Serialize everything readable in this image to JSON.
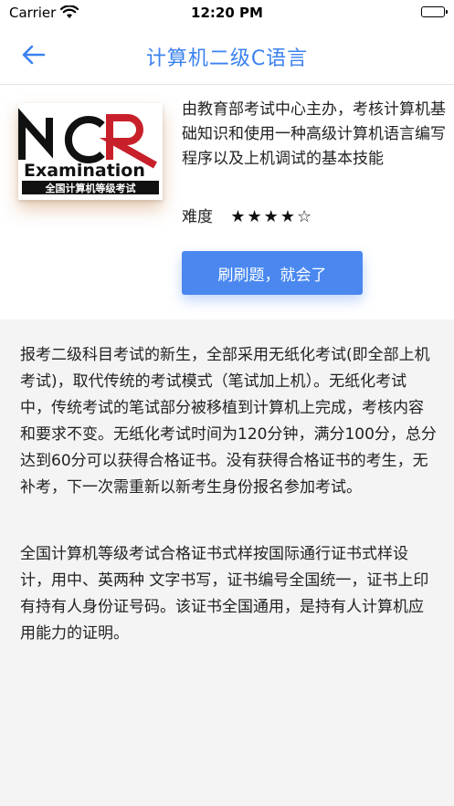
{
  "status_bar": {
    "carrier": "Carrier",
    "time": "12:20 PM"
  },
  "nav": {
    "title": "计算机二级C语言"
  },
  "logo": {
    "text_main": "Examination",
    "text_sub": "全国计算机等级考试"
  },
  "info": {
    "description": "由教育部考试中心主办，考核计算机基础知识和使用一种高级计算机语言编写程序以及上机调试的基本技能",
    "difficulty_label": "难度",
    "difficulty_stars": "★★★★☆",
    "difficulty_value": 4,
    "difficulty_max": 5,
    "cta_label": "刷刷题，就会了"
  },
  "content": {
    "paragraph_1": "报考二级科目考试的新生，全部采用无纸化考试(即全部上机考试)，取代传统的考试模式（笔试加上机）。无纸化考试中，传统考试的笔试部分被移植到计算机上完成，考核内容和要求不变。无纸化考试时间为120分钟，满分100分，总分达到60分可以获得合格证书。没有获得合格证书的考生，无补考，下一次需重新以新考生身份报名参加考试。",
    "paragraph_2": "全国计算机等级考试合格证书式样按国际通行证书式样设计，用中、英两种 文字书写，证书编号全国统一，证书上印有持有人身份证号码。该证书全国通用，是持有人计算机应用能力的证明。"
  },
  "colors": {
    "accent": "#3b82f0",
    "button": "#4a88f0",
    "logo_red": "#c8202a"
  }
}
